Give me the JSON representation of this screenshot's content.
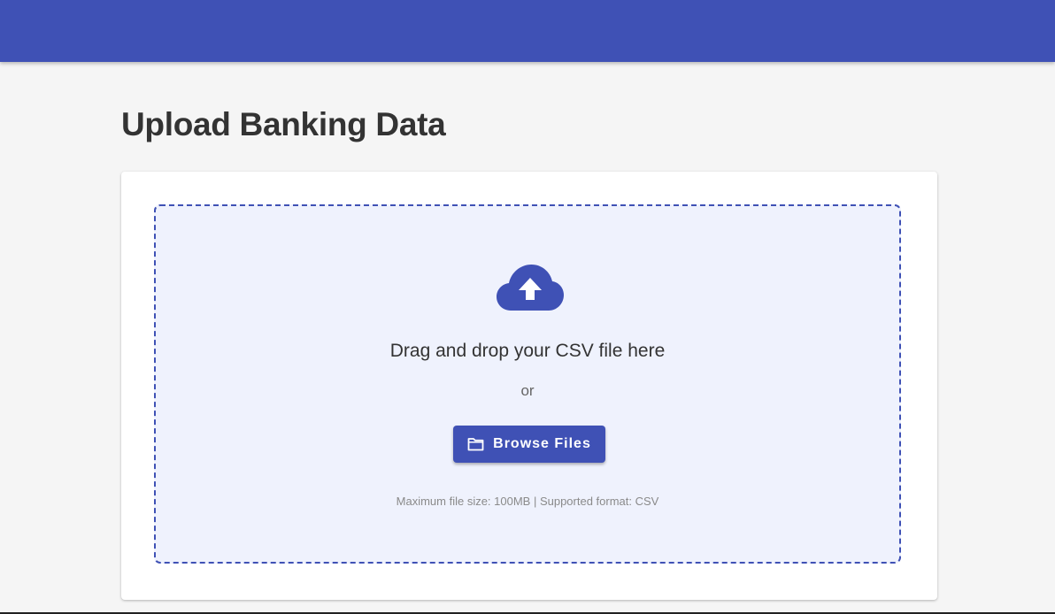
{
  "colors": {
    "primary": "#3f51b5",
    "background": "#f5f5f5",
    "dropzone_bg": "#eff2fd",
    "title_text": "#333333"
  },
  "header": {
    "title": ""
  },
  "main": {
    "title": "Upload Banking Data"
  },
  "dropzone": {
    "icon": "cloud-upload-icon",
    "prompt": "Drag and drop your CSV file here",
    "separator": "or",
    "browse_button": {
      "icon": "folder-icon",
      "label": "Browse Files"
    },
    "hint": "Maximum file size: 100MB | Supported format: CSV"
  }
}
